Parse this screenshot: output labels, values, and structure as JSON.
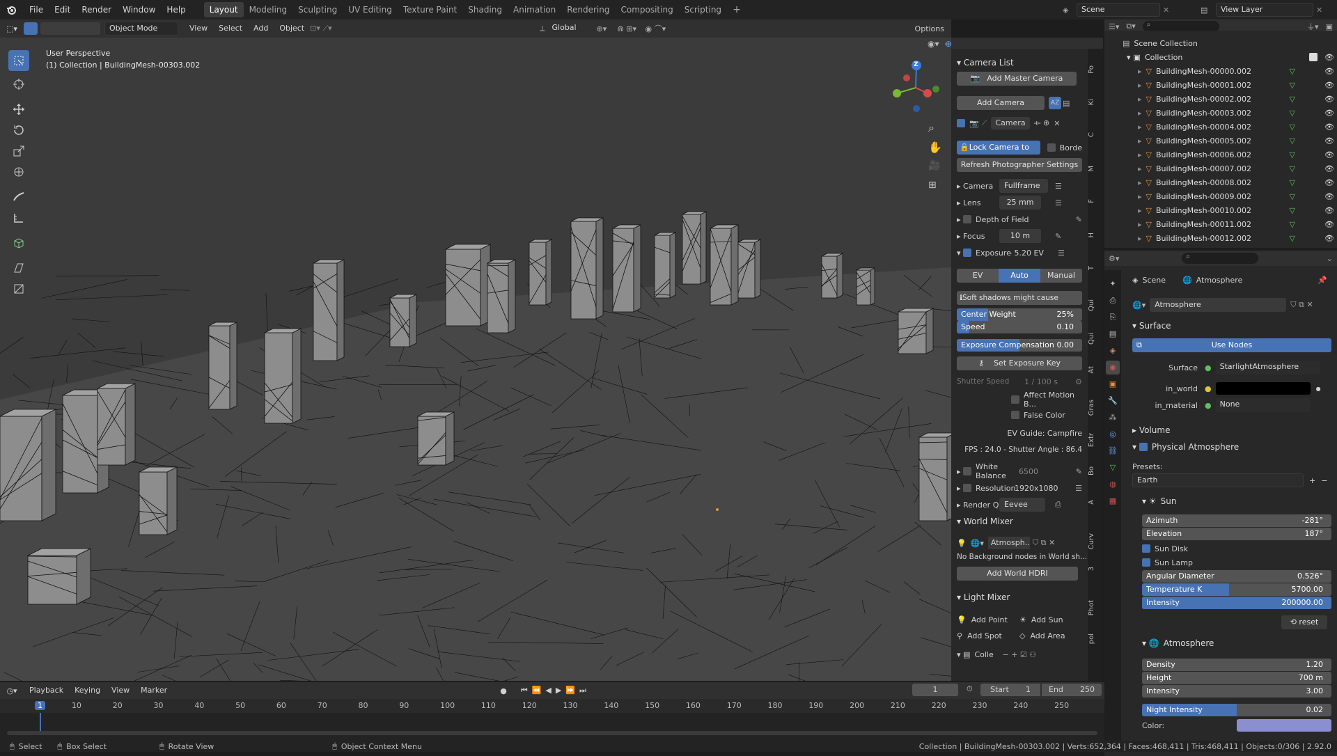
{
  "topbar": {
    "menus": [
      "File",
      "Edit",
      "Render",
      "Window",
      "Help"
    ],
    "workspaces": [
      "Layout",
      "Modeling",
      "Sculpting",
      "UV Editing",
      "Texture Paint",
      "Shading",
      "Animation",
      "Rendering",
      "Compositing",
      "Scripting"
    ],
    "active_workspace": "Layout",
    "scene": "Scene",
    "view_layer": "View Layer"
  },
  "viewport_header": {
    "mode": "Object Mode",
    "menus": [
      "View",
      "Select",
      "Add",
      "Object"
    ],
    "transform": "Global",
    "options": "Options"
  },
  "overlay": {
    "perspective": "User Perspective",
    "collection_info": "(1) Collection | BuildingMesh-00303.002"
  },
  "gizmo": {
    "z": "Z"
  },
  "camera_panel": {
    "camera_list": "Camera List",
    "add_master_camera": "Add Master Camera",
    "add_camera": "Add Camera",
    "camera_name": "Camera",
    "lock_camera": "Lock Camera to Vi...",
    "borde": "Borde",
    "refresh": "Refresh Photographer Settings",
    "camera_label": "Camera",
    "sensor": "Fullframe",
    "lens_label": "Lens",
    "lens_value": "25 mm",
    "dof_label": "Depth of Field",
    "focus_label": "Focus",
    "focus_value": "10 m",
    "exposure_label": "Exposure",
    "exposure_value": "- 5.20 EV",
    "ev_modes": [
      "EV",
      "Auto",
      "Manual"
    ],
    "active_ev_mode": "Auto",
    "shadows_warning": "Soft shadows might cause issues",
    "center_weight_label": "Center Weight",
    "center_weight_value": "25%",
    "speed_label": "Speed",
    "speed_value": "0.10",
    "exp_comp_label": "Exposure Compensation",
    "exp_comp_value": "0.00",
    "set_exposure_key": "Set Exposure Key",
    "shutter_label": "Shutter Speed",
    "shutter_value": "1 / 100 s",
    "affect_motion": "Affect Motion B...",
    "false_color": "False Color",
    "ev_guide": "EV Guide: Campfire",
    "fps_info": "FPS : 24.0 - Shutter Angle : 86.4",
    "white_balance": "White Balance",
    "white_balance_value": "6500",
    "resolution": "Resolution",
    "resolution_value": "1920x1080",
    "render_q": "Render Q",
    "render_engine": "Eevee",
    "world_mixer": "World Mixer",
    "world_name": "Atmosph...",
    "no_background": "No Background nodes in World sh...",
    "add_world_hdri": "Add World HDRI",
    "light_mixer": "Light Mixer",
    "add_point": "Add Point",
    "add_sun": "Add Sun",
    "add_spot": "Add Spot",
    "add_area": "Add Area",
    "colle": "Colle"
  },
  "ntabs": [
    "Po",
    "Ki",
    "C",
    "M",
    "F",
    "H",
    "T",
    "Qui",
    "Qui",
    "At",
    "Gras",
    "Extr",
    "Bo",
    "A",
    "Curv",
    "3",
    "Phot",
    "pol"
  ],
  "outliner": {
    "scene_collection": "Scene Collection",
    "collection": "Collection",
    "items": [
      "BuildingMesh-00000.002",
      "BuildingMesh-00001.002",
      "BuildingMesh-00002.002",
      "BuildingMesh-00003.002",
      "BuildingMesh-00004.002",
      "BuildingMesh-00005.002",
      "BuildingMesh-00006.002",
      "BuildingMesh-00007.002",
      "BuildingMesh-00008.002",
      "BuildingMesh-00009.002",
      "BuildingMesh-00010.002",
      "BuildingMesh-00011.002",
      "BuildingMesh-00012.002"
    ]
  },
  "properties": {
    "breadcrumb_scene": "Scene",
    "breadcrumb_world": "Atmosphere",
    "world_name": "Atmosphere",
    "surface_section": "Surface",
    "use_nodes": "Use Nodes",
    "surface_label": "Surface",
    "surface_value": "StarlightAtmosphere",
    "in_world_label": "in_world",
    "in_material_label": "in_material",
    "in_material_value": "None",
    "volume_section": "Volume",
    "physical_atmosphere": "Physical Atmosphere",
    "presets_label": "Presets:",
    "preset_value": "Earth",
    "sun_section": "Sun",
    "azimuth_label": "Azimuth",
    "azimuth_value": "-281°",
    "elevation_label": "Elevation",
    "elevation_value": "187°",
    "sun_disk": "Sun Disk",
    "sun_lamp": "Sun Lamp",
    "angular_label": "Angular Diameter",
    "angular_value": "0.526°",
    "temp_label": "Temperature K",
    "temp_value": "5700.00",
    "temp_fill": 0.46,
    "intensity_label": "Intensity",
    "intensity_value": "200000.00",
    "reset": "reset",
    "atmosphere_section": "Atmosphere",
    "density_label": "Density",
    "density_value": "1.20",
    "height_label": "Height",
    "height_value": "700 m",
    "atm_intensity_label": "Intensity",
    "atm_intensity_value": "3.00",
    "night_label": "Night Intensity",
    "night_value": "0.02",
    "night_fill": 0.5,
    "color_label": "Color:"
  },
  "timeline": {
    "menus": [
      "Playback",
      "Keying",
      "View",
      "Marker"
    ],
    "current_frame": "1",
    "start_label": "Start",
    "start_value": "1",
    "end_label": "End",
    "end_value": "250",
    "ticks": [
      "1",
      "10",
      "20",
      "30",
      "40",
      "50",
      "60",
      "70",
      "80",
      "90",
      "100",
      "110",
      "120",
      "130",
      "140",
      "150",
      "160",
      "170",
      "180",
      "190",
      "200",
      "210",
      "220",
      "230",
      "240",
      "250"
    ]
  },
  "statusbar": {
    "select": "Select",
    "box_select": "Box Select",
    "rotate_view": "Rotate View",
    "context_menu": "Object Context Menu",
    "stats": "Collection | BuildingMesh-00303.002 | Verts:652,364 | Faces:468,411 | Tris:468,411 | Objects:0/306 | 2.92.0"
  },
  "colors": {
    "accent": "#4772b3",
    "panel": "#282828",
    "viewport": "#3b3b3b",
    "mesh_icon": "#e8923a",
    "data_icon": "#5fbf5f"
  }
}
